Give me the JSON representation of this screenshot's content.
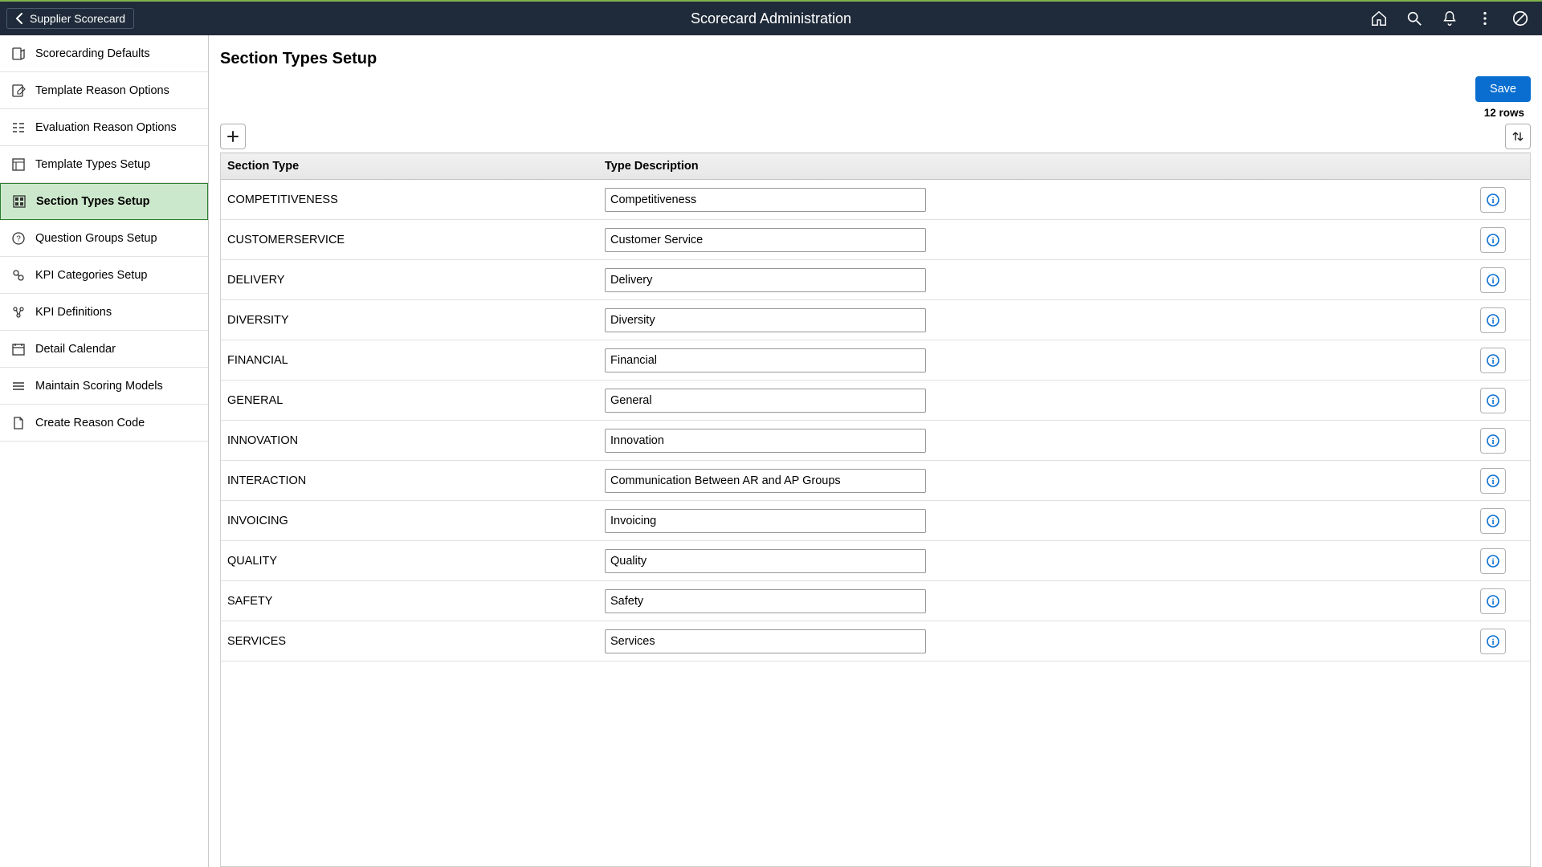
{
  "header": {
    "back_label": "Supplier Scorecard",
    "title": "Scorecard Administration"
  },
  "sidebar": {
    "items": [
      {
        "label": "Scorecarding Defaults",
        "icon": "defaults-icon",
        "selected": false
      },
      {
        "label": "Template Reason Options",
        "icon": "template-reason-icon",
        "selected": false
      },
      {
        "label": "Evaluation Reason Options",
        "icon": "evaluation-reason-icon",
        "selected": false
      },
      {
        "label": "Template Types Setup",
        "icon": "template-types-icon",
        "selected": false
      },
      {
        "label": "Section Types Setup",
        "icon": "section-types-icon",
        "selected": true
      },
      {
        "label": "Question Groups Setup",
        "icon": "question-groups-icon",
        "selected": false
      },
      {
        "label": "KPI Categories Setup",
        "icon": "kpi-categories-icon",
        "selected": false
      },
      {
        "label": "KPI Definitions",
        "icon": "kpi-definitions-icon",
        "selected": false
      },
      {
        "label": "Detail Calendar",
        "icon": "calendar-icon",
        "selected": false
      },
      {
        "label": "Maintain Scoring Models",
        "icon": "scoring-models-icon",
        "selected": false
      },
      {
        "label": "Create Reason Code",
        "icon": "reason-code-icon",
        "selected": false
      }
    ]
  },
  "page": {
    "title": "Section Types Setup",
    "save_label": "Save",
    "rows_label": "12 rows",
    "columns": {
      "section_type": "Section Type",
      "type_description": "Type Description"
    },
    "rows": [
      {
        "type": "COMPETITIVENESS",
        "desc": "Competitiveness"
      },
      {
        "type": "CUSTOMERSERVICE",
        "desc": "Customer Service"
      },
      {
        "type": "DELIVERY",
        "desc": "Delivery"
      },
      {
        "type": "DIVERSITY",
        "desc": "Diversity"
      },
      {
        "type": "FINANCIAL",
        "desc": "Financial"
      },
      {
        "type": "GENERAL",
        "desc": "General"
      },
      {
        "type": "INNOVATION",
        "desc": "Innovation"
      },
      {
        "type": "INTERACTION",
        "desc": "Communication Between AR and AP Groups"
      },
      {
        "type": "INVOICING",
        "desc": "Invoicing"
      },
      {
        "type": "QUALITY",
        "desc": "Quality"
      },
      {
        "type": "SAFETY",
        "desc": "Safety"
      },
      {
        "type": "SERVICES",
        "desc": "Services"
      }
    ]
  }
}
